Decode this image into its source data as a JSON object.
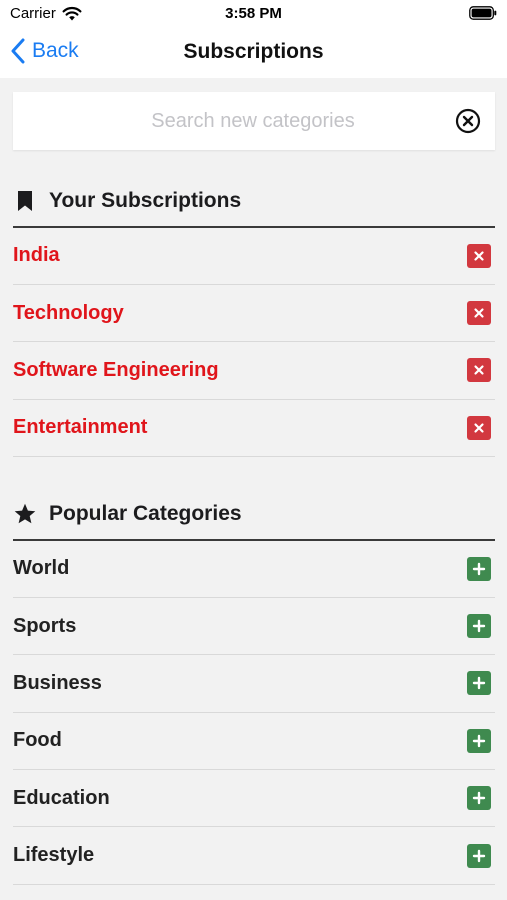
{
  "status_bar": {
    "carrier": "Carrier",
    "time": "3:58 PM"
  },
  "nav": {
    "back_label": "Back",
    "title": "Subscriptions"
  },
  "search": {
    "placeholder": "Search new categories",
    "value": ""
  },
  "your_subscriptions": {
    "title": "Your Subscriptions",
    "icon": "bookmark-icon",
    "items": [
      {
        "label": "India"
      },
      {
        "label": "Technology"
      },
      {
        "label": "Software Engineering"
      },
      {
        "label": "Entertainment"
      }
    ]
  },
  "popular_categories": {
    "title": "Popular Categories",
    "icon": "star-icon",
    "items": [
      {
        "label": "World"
      },
      {
        "label": "Sports"
      },
      {
        "label": "Business"
      },
      {
        "label": "Food"
      },
      {
        "label": "Education"
      },
      {
        "label": "Lifestyle"
      }
    ]
  },
  "colors": {
    "accent_blue": "#1a7cf2",
    "subscribed_red": "#e0151b",
    "remove_red": "#d2383f",
    "add_green": "#3f8a4f"
  }
}
